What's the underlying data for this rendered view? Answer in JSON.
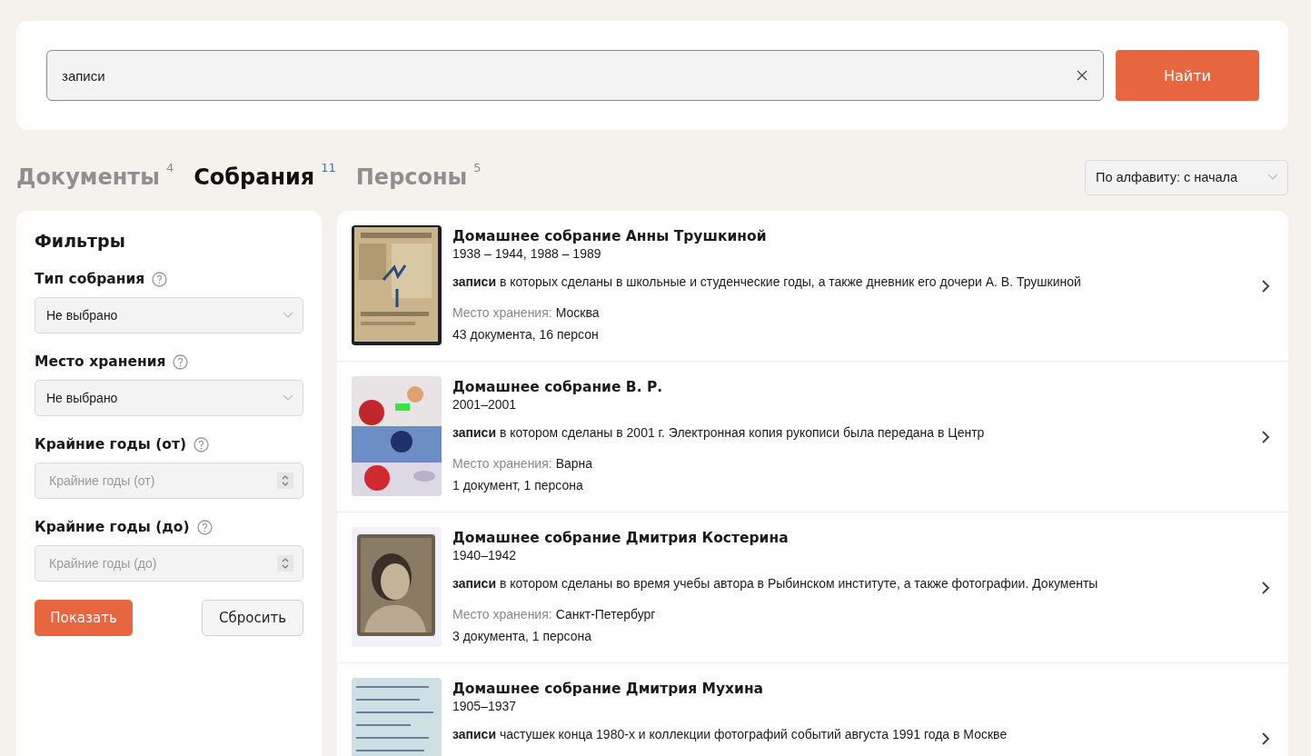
{
  "search": {
    "value": "записи",
    "button": "Найти"
  },
  "tabs": [
    {
      "label": "Документы",
      "count": "4",
      "selected": false
    },
    {
      "label": "Собрания",
      "count": "11",
      "selected": true
    },
    {
      "label": "Персоны",
      "count": "5",
      "selected": false
    }
  ],
  "sort": {
    "value": "По алфавиту: с начала"
  },
  "filters": {
    "title": "Фильтры",
    "fields": [
      {
        "kind": "select",
        "label": "Тип собрания",
        "value": "Не выбрано"
      },
      {
        "kind": "select",
        "label": "Место хранения",
        "value": "Не выбрано"
      },
      {
        "kind": "number",
        "label": "Крайние годы (от)",
        "placeholder": "Крайние годы (от)"
      },
      {
        "kind": "number",
        "label": "Крайние годы (до)",
        "placeholder": "Крайние годы (до)"
      }
    ],
    "apply_button": "Показать",
    "reset_button": "Сбросить"
  },
  "results": [
    {
      "title": "Домашнее собрание Анны Трушкиной",
      "years": "1938 – 1944, 1988 – 1989",
      "snippet": "**записи** в которых сделаны в школьные и студенческие годы, а также дневник его дочери А. В. Трушкиной",
      "place_label": "Место хранения:",
      "place": "Москва",
      "counts": "43 документа, 16 персон"
    },
    {
      "title": "Домашнее собрание В. Р.",
      "years": "2001–2001",
      "snippet": "**записи** в котором сделаны в 2001 г.  Электронная копия рукописи была передана в Центр",
      "place_label": "Место хранения:",
      "place": "Варна",
      "counts": "1 документ, 1 персона"
    },
    {
      "title": "Домашнее собрание Дмитрия Костерина",
      "years": "1940–1942",
      "snippet": "**записи** в котором сделаны во время учебы автора в Рыбинском институте, а также фотографии.  Документы",
      "place_label": "Место хранения:",
      "place": "Санкт-Петербург",
      "counts": "3 документа, 1 персона"
    },
    {
      "title": "Домашнее собрание Дмитрия Мухина",
      "years": "1905–1937",
      "snippet": "**записи** частушек конца 1980-х и коллекции фотографий событий августа 1991 года в Москве"
    }
  ]
}
